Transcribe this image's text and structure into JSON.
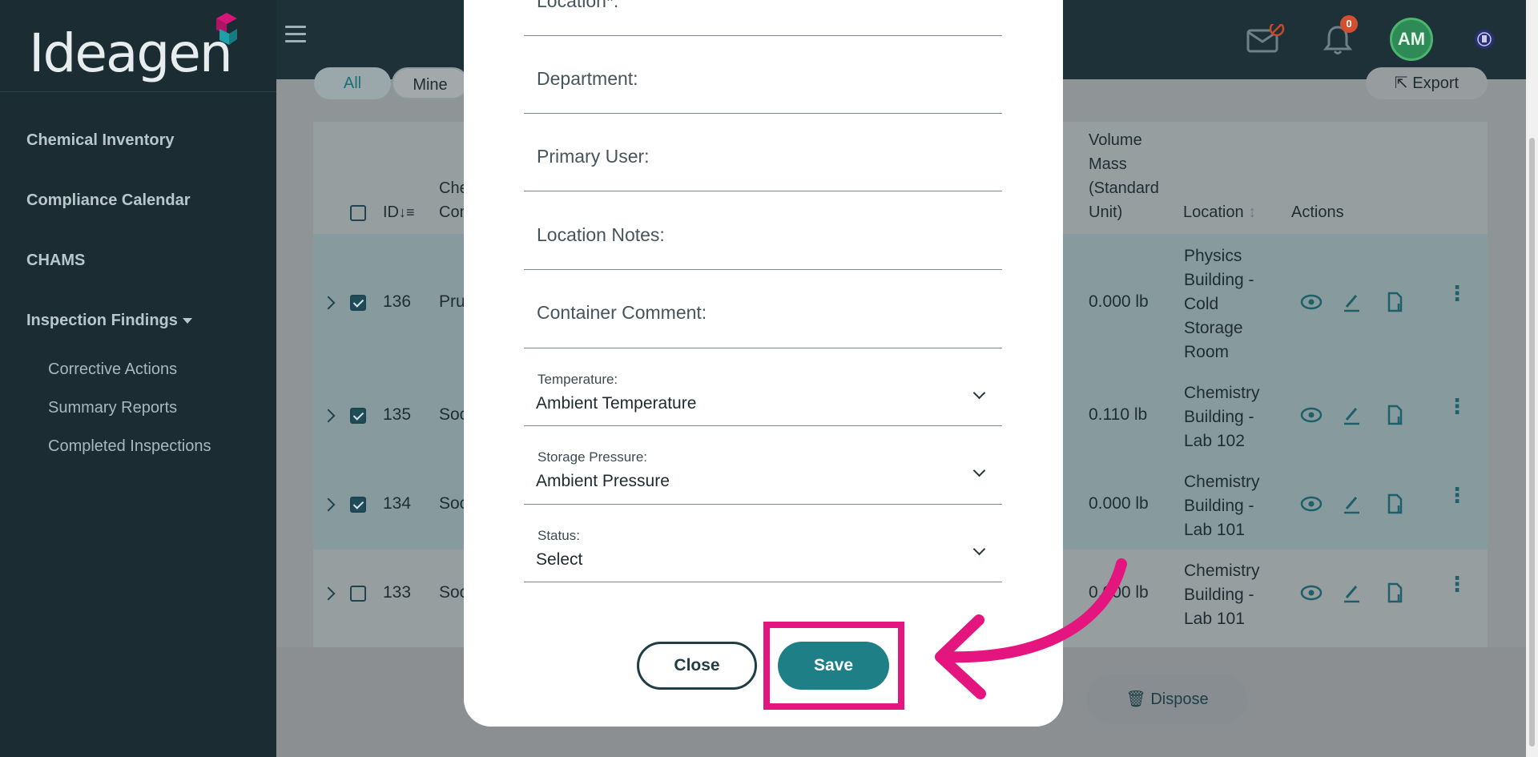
{
  "brand": {
    "name": "Ideagen"
  },
  "sidebar": {
    "items": [
      {
        "label": "Chemical Inventory"
      },
      {
        "label": "Compliance Calendar"
      },
      {
        "label": "CHAMS"
      },
      {
        "label": "Inspection Findings"
      }
    ],
    "subitems": [
      {
        "label": "Corrective Actions"
      },
      {
        "label": "Summary Reports"
      },
      {
        "label": "Completed Inspections"
      }
    ]
  },
  "topbar": {
    "notification_count": "0",
    "avatar_initials": "AM"
  },
  "filters": {
    "all": "All",
    "mine": "Mine",
    "export": "Export"
  },
  "table": {
    "headers": {
      "id": "ID",
      "chemical": "Che Con",
      "volume_mass": [
        "Volume",
        "Mass",
        "(Standard",
        "Unit)"
      ],
      "location": "Location",
      "actions": "Actions"
    },
    "rows": [
      {
        "id": "136",
        "chem": "Pru",
        "qty": "0.000 lb",
        "location": [
          "Physics",
          "Building -",
          "Cold",
          "Storage",
          "Room"
        ],
        "checked": true
      },
      {
        "id": "135",
        "chem": "Soc",
        "qty": "0.110 lb",
        "location": [
          "Chemistry",
          "Building -",
          "Lab 102"
        ],
        "checked": true
      },
      {
        "id": "134",
        "chem": "Soc",
        "qty": "0.000 lb",
        "location": [
          "Chemistry",
          "Building -",
          "Lab 101"
        ],
        "checked": true
      },
      {
        "id": "133",
        "chem": "Soc",
        "qty": "0.000 lb",
        "location": [
          "Chemistry",
          "Building -",
          "Lab 101"
        ],
        "checked": false
      }
    ]
  },
  "footer": {
    "dispose_label": "Dispose"
  },
  "modal": {
    "fields": {
      "location": "Location*:",
      "department": "Department:",
      "primary_user": "Primary User:",
      "location_notes": "Location Notes:",
      "container_comment": "Container Comment:"
    },
    "selects": {
      "temperature": {
        "label": "Temperature:",
        "value": "Ambient Temperature"
      },
      "storage_pressure": {
        "label": "Storage Pressure:",
        "value": "Ambient Pressure"
      },
      "status": {
        "label": "Status:",
        "value": "Select"
      }
    },
    "close_label": "Close",
    "save_label": "Save"
  },
  "colors": {
    "accent": "#1e7f86",
    "highlight": "#e5157f",
    "sidebar": "#1b2c33"
  }
}
